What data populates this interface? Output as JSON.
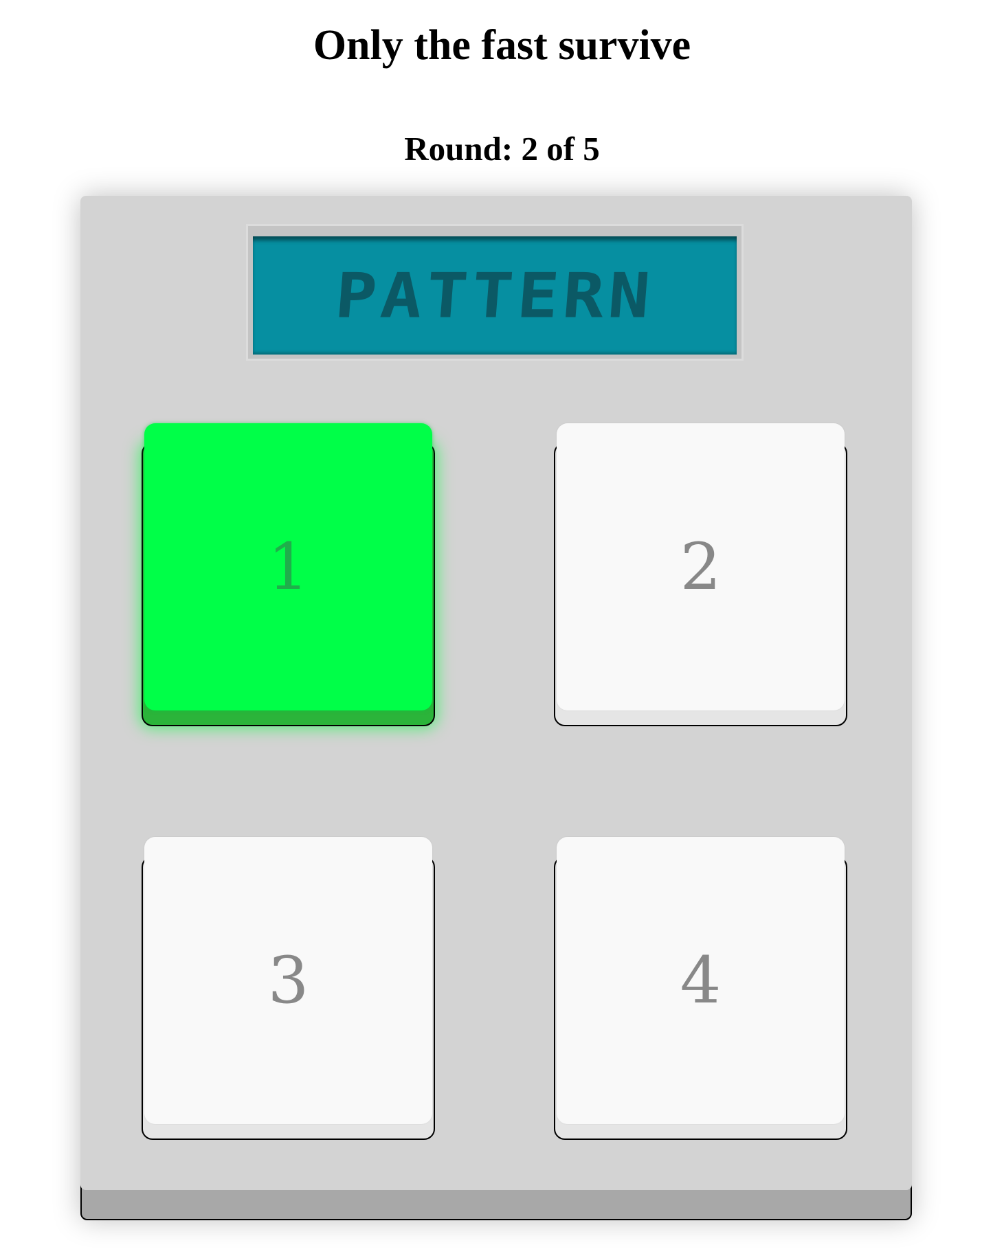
{
  "header": {
    "title": "Only the fast survive",
    "round_text": "Round: 2 of 5"
  },
  "display": {
    "text": "PATTERN",
    "background_color": "#068fa1",
    "text_color": "#0b5965"
  },
  "pads": [
    {
      "label": "1",
      "state": "lit",
      "color": "#00ff48"
    },
    {
      "label": "2",
      "state": "idle",
      "color": "#f9f9f9"
    },
    {
      "label": "3",
      "state": "idle",
      "color": "#f9f9f9"
    },
    {
      "label": "4",
      "state": "idle",
      "color": "#f9f9f9"
    }
  ]
}
